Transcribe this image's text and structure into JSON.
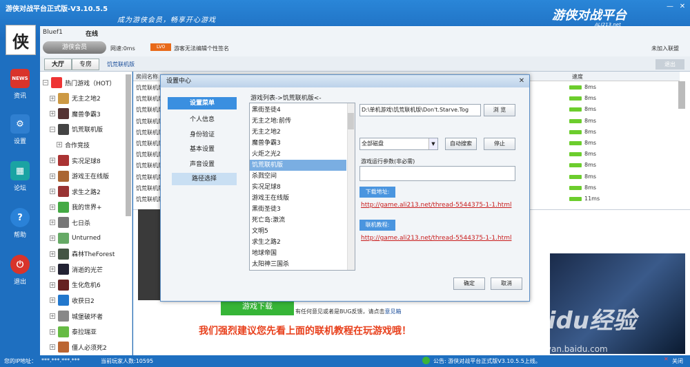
{
  "app": {
    "title": "游侠对战平台正式版-V3.10.5.5",
    "slogan": "成为游侠会员，畅享开心游戏",
    "brand": "游侠对战平台",
    "brand_sub": "ALI213.net"
  },
  "window_controls": {
    "minimize": "—",
    "close": "✕"
  },
  "profile": {
    "username": "Bluef1",
    "status": "在线",
    "logo_text": "游侠会员",
    "network": "网速:0ms",
    "level": "LV0",
    "signature": "游客无法编辑个性签名",
    "guild": "未加入联盟"
  },
  "tabs": {
    "hall": "大厅",
    "zone": "专房",
    "current": "饥荒联机版",
    "exit": "退出"
  },
  "nav": [
    {
      "label": "资讯",
      "icon": "news-icon",
      "color": "#d9342b",
      "glyph": "NEWS"
    },
    {
      "label": "设置",
      "icon": "settings-icon",
      "color": "#2f7fd0",
      "glyph": "⚙"
    },
    {
      "label": "论坛",
      "icon": "forum-icon",
      "color": "#1aa3a3",
      "glyph": "▦"
    },
    {
      "label": "帮助",
      "icon": "help-icon",
      "color": "#2a82d8",
      "glyph": "?"
    },
    {
      "label": "退出",
      "icon": "power-icon",
      "color": "#d8342b",
      "glyph": "⏻"
    }
  ],
  "tree": [
    {
      "label": "热门游戏（HOT）",
      "pm": "−",
      "icon_color": "#e33",
      "indent": 0
    },
    {
      "label": "无主之地2",
      "pm": "+",
      "icon_color": "#c94",
      "indent": 1
    },
    {
      "label": "魔兽争霸3",
      "pm": "+",
      "icon_color": "#533",
      "indent": 1
    },
    {
      "label": "饥荒联机版",
      "pm": "−",
      "icon_color": "#444",
      "indent": 1
    },
    {
      "label": "合作竞技",
      "pm": "+",
      "icon_color": "",
      "indent": 2
    },
    {
      "label": "实况足球8",
      "pm": "+",
      "icon_color": "#a33",
      "indent": 1
    },
    {
      "label": "游戏王在线版",
      "pm": "+",
      "icon_color": "#a63",
      "indent": 1
    },
    {
      "label": "求生之路2",
      "pm": "+",
      "icon_color": "#933",
      "indent": 1
    },
    {
      "label": "我的世界+",
      "pm": "+",
      "icon_color": "#4a4",
      "indent": 1
    },
    {
      "label": "七日杀",
      "pm": "+",
      "icon_color": "#777",
      "indent": 1
    },
    {
      "label": "Unturned",
      "pm": "+",
      "icon_color": "#6a6",
      "indent": 1
    },
    {
      "label": "森林TheForest",
      "pm": "+",
      "icon_color": "#454",
      "indent": 1
    },
    {
      "label": "消逝的光芒",
      "pm": "+",
      "icon_color": "#223",
      "indent": 1
    },
    {
      "label": "生化危机6",
      "pm": "+",
      "icon_color": "#622",
      "indent": 1
    },
    {
      "label": "收获日2",
      "pm": "+",
      "icon_color": "#27c",
      "indent": 1
    },
    {
      "label": "城堡破坏者",
      "pm": "+",
      "icon_color": "#888",
      "indent": 1
    },
    {
      "label": "泰拉瑞亚",
      "pm": "+",
      "icon_color": "#6b4",
      "indent": 1
    },
    {
      "label": "僵人必须死2",
      "pm": "+",
      "icon_color": "#b63",
      "indent": 1
    }
  ],
  "rooms": {
    "header_name": "房间名称",
    "header_speed": "速度",
    "rows": [
      {
        "name": "饥荒联机版",
        "speed": "8ms"
      },
      {
        "name": "饥荒联机版",
        "speed": "8ms"
      },
      {
        "name": "饥荒联机版",
        "speed": "8ms"
      },
      {
        "name": "饥荒联机版",
        "speed": "8ms"
      },
      {
        "name": "饥荒联机版",
        "speed": "8ms"
      },
      {
        "name": "饥荒联机版",
        "speed": "8ms"
      },
      {
        "name": "饥荒联机版",
        "speed": "8ms"
      },
      {
        "name": "饥荒联机版",
        "speed": "8ms"
      },
      {
        "name": "饥荒联机版",
        "speed": "8ms"
      },
      {
        "name": "饥荒联机版",
        "speed": "8ms"
      },
      {
        "name": "饥荒联机版",
        "speed": "11ms"
      }
    ]
  },
  "bottom": {
    "download": "游戏下载",
    "feedback_prefix": "有任何意见或者是BUG反馈，请点击",
    "feedback_link": "意见箱",
    "recommend": "我们强烈建议您先看上面的联机教程在玩游戏哦！",
    "watermark": "Baidu经验",
    "watermark_url": "jingyan.baidu.com"
  },
  "status": {
    "ip_label": "您的IP地址：",
    "ip": "***.***.***.***",
    "players": "当前玩家人数:10595",
    "notice": "公告: 游侠对战平台正式版V3.10.5.5上线。",
    "close": "关闭"
  },
  "dialog": {
    "title": "设置中心",
    "menu_header": "设置菜单",
    "menu": [
      "个人信息",
      "身份验证",
      "基本设置",
      "声音设置",
      "路径选择"
    ],
    "selected_menu_index": 4,
    "list_label": "游戏列表->饥荒联机版<-",
    "games": [
      "黑街圣徒4",
      "无主之地:前传",
      "无主之地2",
      "魔兽争霸3",
      "火炬之光2",
      "饥荒联机版",
      "杀戮空间",
      "实况足球8",
      "游戏王在线版",
      "黑街圣徒3",
      "死亡岛:激流",
      "文明5",
      "求生之路2",
      "地球帝国",
      "太阳神三国杀"
    ],
    "selected_game_index": 5,
    "path": "D:\\单机游戏\\饥荒联机版\\Don't.Starve.Tog",
    "browse": "浏 览",
    "drive": "全部磁盘",
    "auto_search": "自动搜索",
    "stop": "停止",
    "args_label": "游戏运行参数(非必需)",
    "args_value": "",
    "download_label": "下载地址:",
    "download_url": "http://game.ali213.net/thread-5544375-1-1.html",
    "tutorial_label": "联机教程:",
    "tutorial_url": "http://game.ali213.net/thread-5544375-1-1.html",
    "ok": "确定",
    "cancel": "取消"
  }
}
